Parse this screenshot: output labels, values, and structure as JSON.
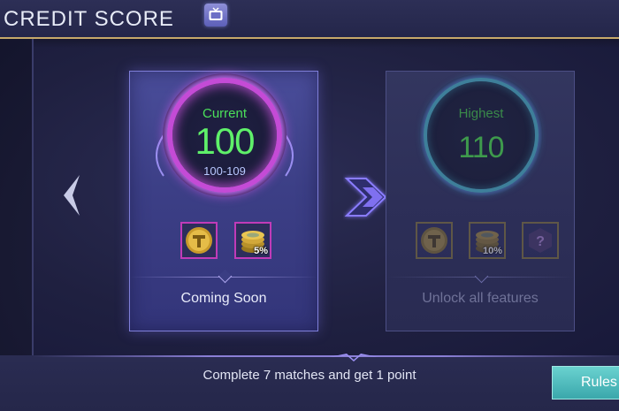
{
  "header": {
    "title": "CREDIT SCORE",
    "tv_icon": "tv-icon"
  },
  "current_card": {
    "label": "Current",
    "value": "100",
    "range": "100-109",
    "footer": "Coming Soon",
    "features": [
      {
        "icon": "gold-token-icon",
        "badge": ""
      },
      {
        "icon": "coin-stack-icon",
        "badge": "5%"
      }
    ]
  },
  "highest_card": {
    "label": "Highest",
    "value": "110",
    "footer": "Unlock all features",
    "features": [
      {
        "icon": "gold-token-icon",
        "badge": ""
      },
      {
        "icon": "coin-stack-icon",
        "badge": "10%"
      },
      {
        "icon": "mystery-icon",
        "badge": ""
      }
    ]
  },
  "footer": {
    "message": "Complete 7 matches and get 1 point",
    "rules_label": "Rules"
  },
  "colors": {
    "accent_green": "#5ff06a",
    "ring_magenta": "#c44bd6",
    "rules_teal": "#3aa7ab",
    "header_gold": "#c7a96a"
  }
}
